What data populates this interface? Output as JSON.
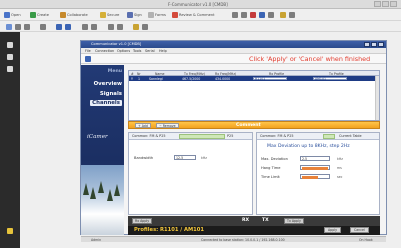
{
  "app": {
    "title": "F-Communicator v1.0 [CMDB]"
  },
  "toolbar1": {
    "items": [
      {
        "label": "Open",
        "color": "#4a74c9"
      },
      {
        "label": "Create",
        "color": "#3a9b48"
      },
      {
        "label": "Collaborate",
        "color": "#c6892b"
      },
      {
        "label": "Secure",
        "color": "#d5b038"
      },
      {
        "label": "Sign",
        "color": "#5a6fb0"
      },
      {
        "label": "Forms",
        "color": "#b2b2b2"
      },
      {
        "label": "Review & Comment",
        "color": "#d44a3b"
      }
    ]
  },
  "window": {
    "title": "Communicator v1.0 [CMDB]",
    "menu": [
      "File",
      "Connection",
      "Options",
      "Tools",
      "Serial",
      "Help"
    ],
    "instruction": "Click 'Apply' or 'Cancel' when finished"
  },
  "nav": {
    "items": [
      {
        "label": "Menu",
        "state": "muted"
      },
      {
        "label": "Overview",
        "state": "normal"
      },
      {
        "label": "Signals",
        "state": "normal"
      },
      {
        "label": "Channels",
        "state": "active"
      }
    ],
    "logo": "iCamer"
  },
  "table": {
    "columns": [
      "#",
      "Nr",
      "Name",
      "Tx Freq(MHz)",
      "Rx Freq(MHz)",
      "Rx Profile",
      "Tx Profile"
    ],
    "rows": [
      {
        "mark": "Y",
        "nr": "1",
        "name": "Sonnlegl",
        "tx_freq": "467.5/2000",
        "rx_freq": "434.0000",
        "rx_profile": "R1101",
        "tx_profile": "AM101"
      }
    ]
  },
  "actionbar": {
    "add_label": "Add",
    "remove_label": "Remove",
    "comment": "Comment"
  },
  "left_panel": {
    "tab_label": "Common:  FM & P25",
    "tab_badge": "P25",
    "field_label": "Bandwidth",
    "field_value": "12.5",
    "field_unit": "kHz"
  },
  "right_panel": {
    "tab_label": "Common:  FM & P25",
    "tab_badge": "Current Table",
    "range_title": "Max Deviation up to 8KHz, step 2Hz",
    "fields": [
      {
        "label": "Max. Deviation",
        "value": "2.5",
        "unit": "kHz",
        "level": 0
      },
      {
        "label": "Hang Time",
        "value": "",
        "unit": "ms",
        "level": 1
      },
      {
        "label": "Time Limit",
        "value": "",
        "unit": "sec",
        "level": 0.6
      }
    ]
  },
  "bottombar": {
    "rx_button": "Rx Apply",
    "rx_label": "RX",
    "tx_label": "TX",
    "tx_button": "Tx Apply"
  },
  "profiles": {
    "text": "Profiles: R1101 / AM101",
    "apply_label": "Apply",
    "cancel_label": "Cancel"
  },
  "status": {
    "left": "Admin",
    "middle": "Connected to base station: 10.0.0.1 / 192.168.0.100",
    "right": "On Hook"
  }
}
